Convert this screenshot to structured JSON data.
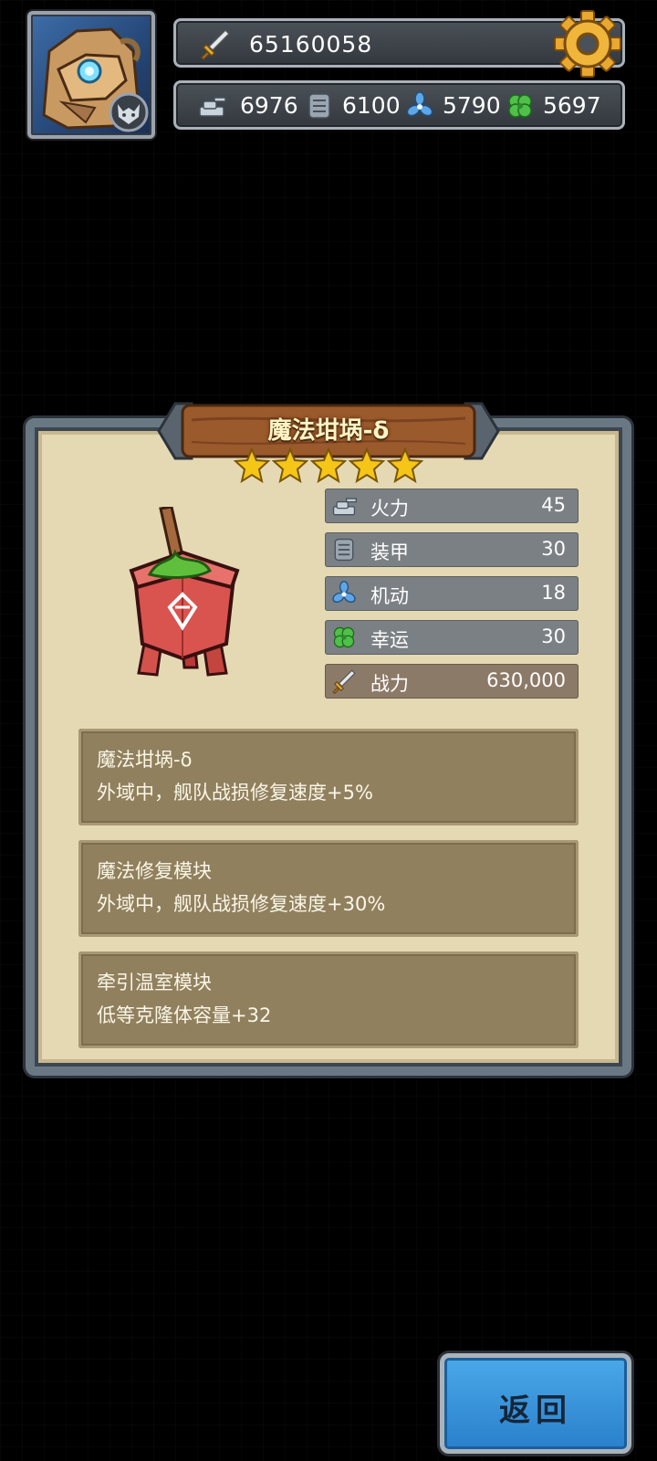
{
  "hud": {
    "total_power": "65160058",
    "resources": [
      {
        "icon": "firepower-icon",
        "value": "6976"
      },
      {
        "icon": "armor-icon",
        "value": "6100"
      },
      {
        "icon": "mobility-icon",
        "value": "5790"
      },
      {
        "icon": "luck-icon",
        "value": "5697"
      }
    ]
  },
  "item": {
    "name": "魔法坩埚-δ",
    "stars": 5,
    "stats": [
      {
        "icon": "firepower-icon",
        "label": "火力",
        "value": "45"
      },
      {
        "icon": "armor-icon",
        "label": "装甲",
        "value": "30"
      },
      {
        "icon": "mobility-icon",
        "label": "机动",
        "value": "18"
      },
      {
        "icon": "luck-icon",
        "label": "幸运",
        "value": "30"
      },
      {
        "icon": "sword-icon",
        "label": "战力",
        "value": "630,000"
      }
    ],
    "effects": [
      {
        "name": "魔法坩埚-δ",
        "text": "外域中，舰队战损修复速度+5%"
      },
      {
        "name": "魔法修复模块",
        "text": "外域中，舰队战损修复速度+30%"
      },
      {
        "name": "牵引温室模块",
        "text": "低等克隆体容量+32"
      }
    ]
  },
  "buttons": {
    "back": "返回"
  },
  "colors": {
    "panel_bg": "#e5d9b4",
    "frame": "#6a7884",
    "stat_row": "#7b8084",
    "power_row": "#8c7a68",
    "effect_box": "#90805e",
    "back_button": "#3a94da",
    "star": "#f5c518",
    "title_text": "#fff4c4"
  }
}
